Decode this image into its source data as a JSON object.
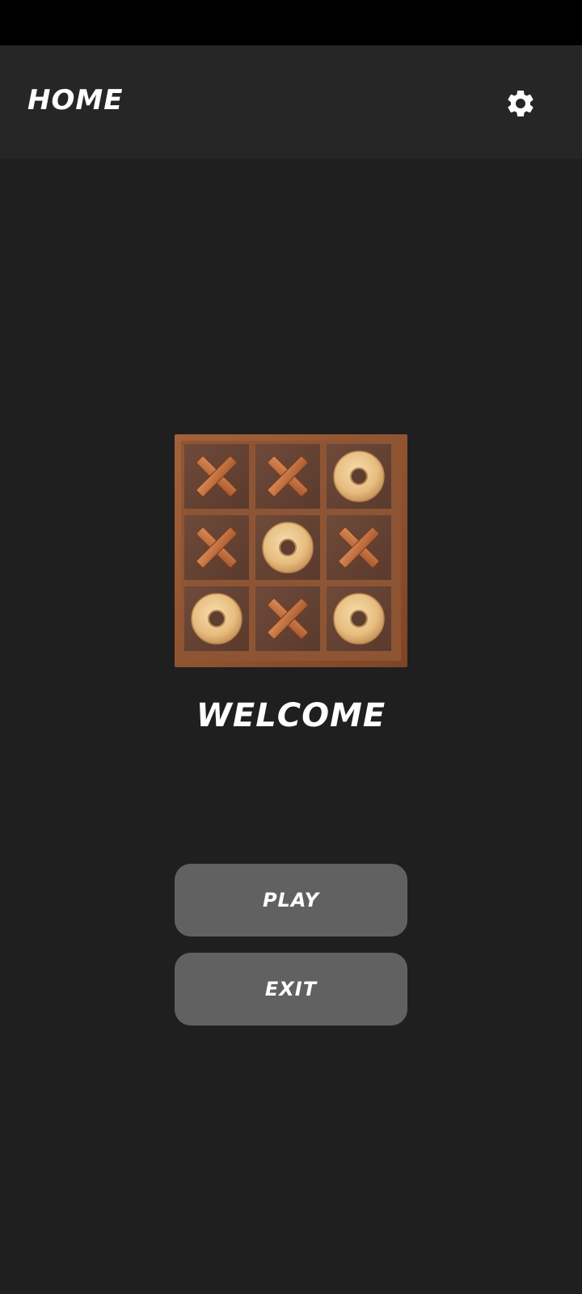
{
  "app_bar": {
    "title": "HOME",
    "settings_icon": "gear-icon"
  },
  "board": {
    "cells": [
      "X",
      "X",
      "O",
      "X",
      "O",
      "X",
      "O",
      "X",
      "O"
    ]
  },
  "main": {
    "welcome": "WELCOME",
    "play_label": "PLAY",
    "exit_label": "EXIT"
  },
  "colors": {
    "background": "#1f1f1f",
    "app_bar": "#262626",
    "button": "#616161",
    "text": "#ffffff"
  }
}
